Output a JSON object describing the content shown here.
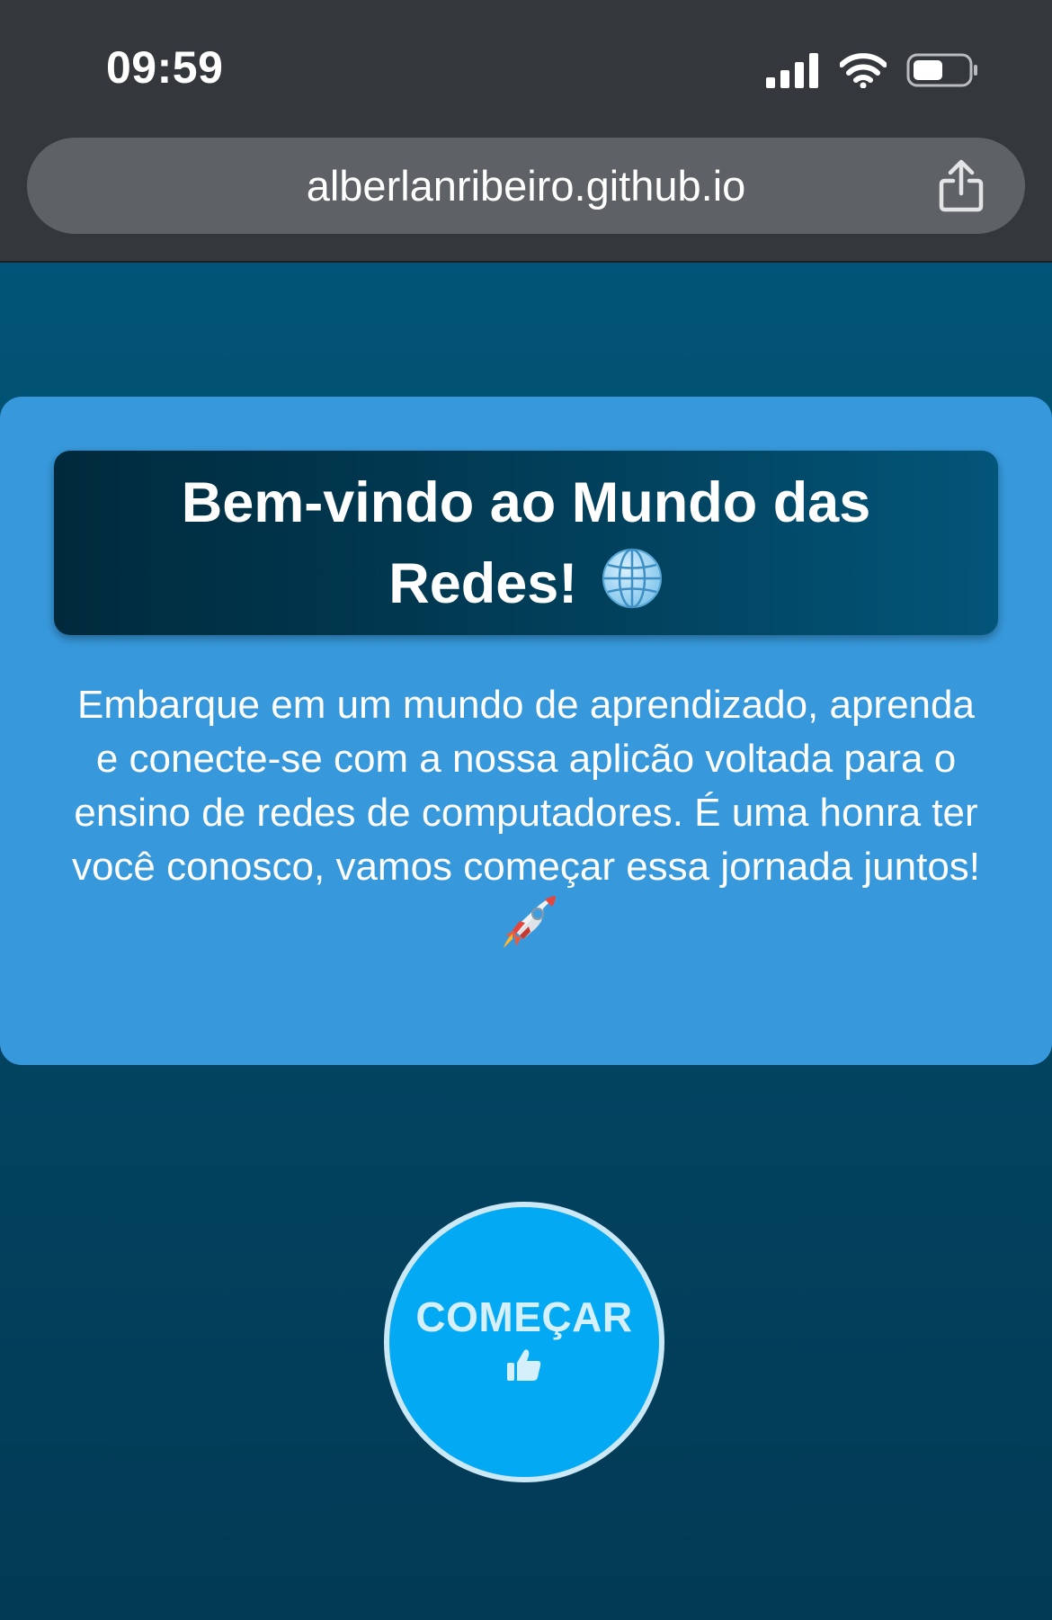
{
  "status_bar": {
    "time": "09:59",
    "icons": [
      "signal-icon",
      "wifi-icon",
      "battery-icon"
    ]
  },
  "browser": {
    "url": "alberlanribeiro.github.io",
    "share_icon": "share-icon"
  },
  "card": {
    "title": "Bem-vindo ao Mundo das Redes!",
    "title_icon": "globe-icon",
    "description": "Embarque em um mundo de aprendizado, aprenda e conecte-se com a nossa aplicão voltada para o ensino de redes de computadores. É uma honra ter você conosco, vamos começar essa jornada juntos!",
    "description_icon": "rocket-icon"
  },
  "start_button": {
    "label": "COMEÇAR",
    "icon": "thumbs-up-icon"
  },
  "colors": {
    "page_background": "#024e70",
    "card_background": "#3799dc",
    "title_background_start": "#002a3c",
    "title_background_end": "#035579",
    "button_background": "#04a9f3",
    "button_border": "#cbe8f6",
    "topbar_background": "#34373b",
    "urlbar_background": "#5e6266"
  }
}
